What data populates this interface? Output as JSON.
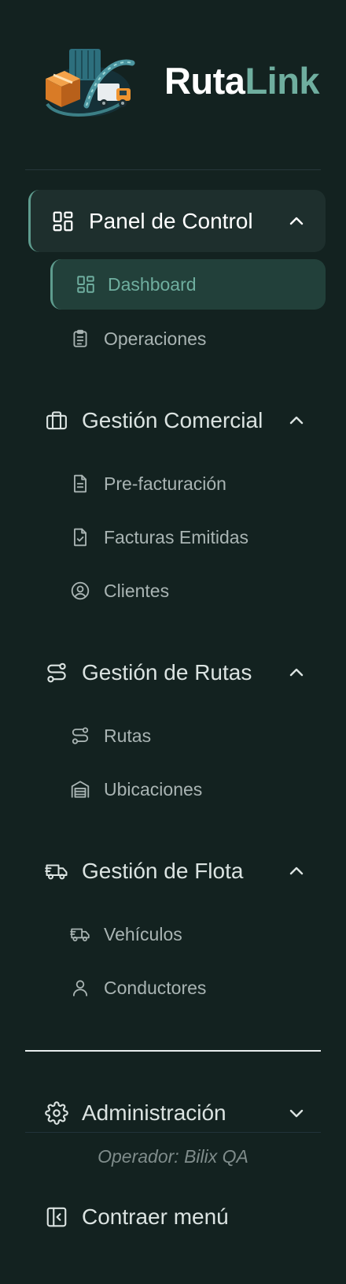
{
  "brand": {
    "part1": "Ruta",
    "part2": "Link",
    "color_light": "#ffffff",
    "color_accent": "#6fae9f",
    "logo_icon": "truck-logistics-logo"
  },
  "accent_color": "#5e9c8e",
  "groups": [
    {
      "label": "Panel de Control",
      "icon": "dashboard-grid-icon",
      "expanded": true,
      "active": true,
      "items": [
        {
          "label": "Dashboard",
          "icon": "dashboard-grid-icon",
          "active": true
        },
        {
          "label": "Operaciones",
          "icon": "clipboard-list-icon"
        }
      ]
    },
    {
      "label": "Gestión Comercial",
      "icon": "briefcase-icon",
      "expanded": true,
      "items": [
        {
          "label": "Pre-facturación",
          "icon": "document-icon"
        },
        {
          "label": "Facturas Emitidas",
          "icon": "document-check-icon"
        },
        {
          "label": "Clientes",
          "icon": "user-circle-icon"
        }
      ]
    },
    {
      "label": "Gestión de Rutas",
      "icon": "route-icon",
      "expanded": true,
      "items": [
        {
          "label": "Rutas",
          "icon": "route-icon"
        },
        {
          "label": "Ubicaciones",
          "icon": "warehouse-icon"
        }
      ]
    },
    {
      "label": "Gestión de Flota",
      "icon": "truck-icon",
      "expanded": true,
      "items": [
        {
          "label": "Vehículos",
          "icon": "truck-icon"
        },
        {
          "label": "Conductores",
          "icon": "user-icon"
        }
      ]
    },
    {
      "label": "Administración",
      "icon": "gear-icon",
      "expanded": false,
      "items": []
    }
  ],
  "operator": "Operador: Bilix QA",
  "collapse_label": "Contraer menú",
  "collapse_icon": "panel-collapse-icon"
}
